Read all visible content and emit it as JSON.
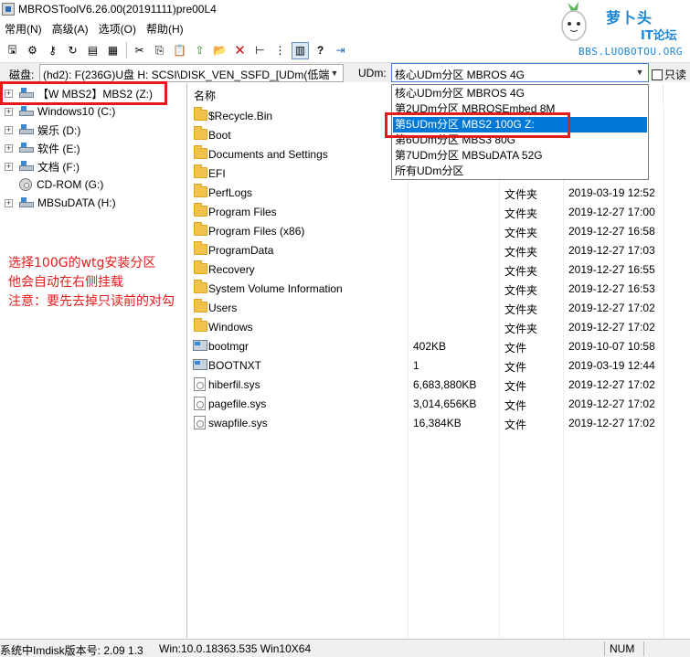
{
  "window": {
    "title": "MBROSToolV6.26.00(20191111)pre00L4"
  },
  "logo": {
    "brand": "萝卜头",
    "brand2": "IT论坛",
    "url": "BBS.LUOBOTOU.ORG"
  },
  "menu": [
    "常用(N)",
    "高级(A)",
    "选项(O)",
    "帮助(H)"
  ],
  "toolbar": [
    {
      "icon": "save-icon",
      "glyph": "🖫"
    },
    {
      "icon": "settings-icon",
      "glyph": "⚙"
    },
    {
      "icon": "key-icon",
      "glyph": "⚷"
    },
    {
      "icon": "refresh-icon",
      "glyph": "↻"
    },
    {
      "icon": "list-icon",
      "glyph": "▤"
    },
    {
      "icon": "grid-icon",
      "glyph": "▦"
    },
    {
      "icon": "cut-icon",
      "glyph": "✂"
    },
    {
      "icon": "copy-icon",
      "glyph": "⎘"
    },
    {
      "icon": "paste-icon",
      "glyph": "📋"
    },
    {
      "icon": "folder-up-icon",
      "glyph": "⇧"
    },
    {
      "icon": "new-folder-icon",
      "glyph": "📂"
    },
    {
      "icon": "delete-icon",
      "glyph": "✕"
    },
    {
      "icon": "tree-view-icon",
      "glyph": "⊢"
    },
    {
      "icon": "details-view-icon",
      "glyph": "⋮"
    },
    {
      "icon": "list-view-icon",
      "glyph": "▥"
    },
    {
      "icon": "help-icon",
      "glyph": "?"
    },
    {
      "icon": "exit-icon",
      "glyph": "⇥"
    }
  ],
  "drivebar": {
    "disk_label": "磁盘:",
    "disk_value": "(hd2): F(236G)U盘 H: SCSI\\DISK_VEN_SSFD_[UDm(低端",
    "udm_label": "UDm:",
    "udm_value": "核心UDm分区 MBROS 4G",
    "readonly_label": "只读"
  },
  "udm_dropdown": [
    "核心UDm分区 MBROS 4G",
    "第2UDm分区 MBROSEmbed 8M",
    "第5UDm分区 MBS2 100G Z:",
    "第6UDm分区 MBS3 80G",
    "第7UDm分区 MBSuDATA 52G",
    "所有UDm分区"
  ],
  "udm_dropdown_selected": 2,
  "tree": [
    {
      "label": "【W MBS2】MBS2 (Z:)",
      "expander": "+",
      "type": "drive"
    },
    {
      "label": "Windows10 (C:)",
      "expander": "+",
      "type": "drive"
    },
    {
      "label": "娱乐 (D:)",
      "expander": "+",
      "type": "drive"
    },
    {
      "label": "软件 (E:)",
      "expander": "+",
      "type": "drive"
    },
    {
      "label": "文档 (F:)",
      "expander": "+",
      "type": "drive"
    },
    {
      "label": "CD-ROM (G:)",
      "expander": "",
      "type": "cd"
    },
    {
      "label": "MBSuDATA (H:)",
      "expander": "+",
      "type": "drive"
    }
  ],
  "note": [
    "选择100G的wtg安装分区",
    "他会自动在右侧挂载",
    "注意：要先去掉只读前的对勾"
  ],
  "columns": {
    "name": "名称"
  },
  "files": [
    {
      "name": "$Recycle.Bin",
      "size": "",
      "type": "",
      "date": "59",
      "icon": "folder"
    },
    {
      "name": "Boot",
      "size": "",
      "type": "",
      "date": "07",
      "icon": "folder"
    },
    {
      "name": "Documents and Settings",
      "size": "",
      "type": "",
      "date": "56",
      "icon": "folder"
    },
    {
      "name": "EFI",
      "size": "",
      "type": "",
      "date": "07",
      "icon": "folder"
    },
    {
      "name": "PerfLogs",
      "size": "",
      "type": "文件夹",
      "date": "2019-03-19 12:52",
      "icon": "folder"
    },
    {
      "name": "Program Files",
      "size": "",
      "type": "文件夹",
      "date": "2019-12-27 17:00",
      "icon": "folder"
    },
    {
      "name": "Program Files (x86)",
      "size": "",
      "type": "文件夹",
      "date": "2019-12-27 16:58",
      "icon": "folder"
    },
    {
      "name": "ProgramData",
      "size": "",
      "type": "文件夹",
      "date": "2019-12-27 17:03",
      "icon": "folder"
    },
    {
      "name": "Recovery",
      "size": "",
      "type": "文件夹",
      "date": "2019-12-27 16:55",
      "icon": "folder"
    },
    {
      "name": "System Volume Information",
      "size": "",
      "type": "文件夹",
      "date": "2019-12-27 16:53",
      "icon": "folder"
    },
    {
      "name": "Users",
      "size": "",
      "type": "文件夹",
      "date": "2019-12-27 17:02",
      "icon": "folder"
    },
    {
      "name": "Windows",
      "size": "",
      "type": "文件夹",
      "date": "2019-12-27 17:02",
      "icon": "folder"
    },
    {
      "name": "bootmgr",
      "size": "402KB",
      "type": "文件",
      "date": "2019-10-07 10:58",
      "icon": "exe"
    },
    {
      "name": "BOOTNXT",
      "size": "1",
      "type": "文件",
      "date": "2019-03-19 12:44",
      "icon": "exe"
    },
    {
      "name": "hiberfil.sys",
      "size": "6,683,880KB",
      "type": "文件",
      "date": "2019-12-27 17:02",
      "icon": "sys"
    },
    {
      "name": "pagefile.sys",
      "size": "3,014,656KB",
      "type": "文件",
      "date": "2019-12-27 17:02",
      "icon": "sys"
    },
    {
      "name": "swapfile.sys",
      "size": "16,384KB",
      "type": "文件",
      "date": "2019-12-27 17:02",
      "icon": "sys"
    }
  ],
  "status": {
    "imdisk": "系统中Imdisk版本号: 2.09 1.3",
    "os": "Win:10.0.18363.535 Win10X64",
    "num": "NUM"
  },
  "colors": {
    "highlight_box": "#e31b1b",
    "selection": "#0078d7",
    "note_text": "#e31b1b"
  }
}
